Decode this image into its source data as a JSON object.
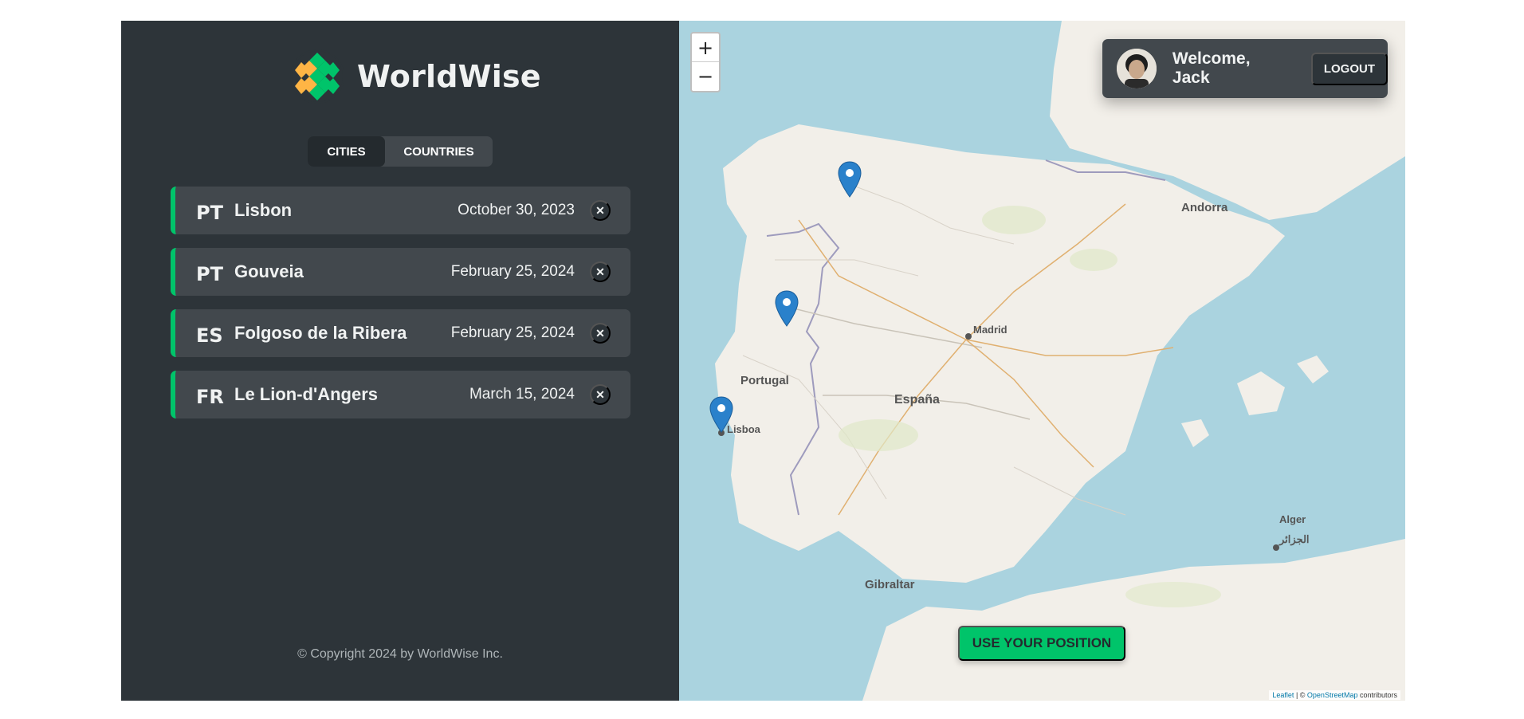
{
  "app": {
    "name": "WorldWise",
    "accent_color": "#00c46a",
    "panel_color": "#2d3439",
    "card_color": "#42484d"
  },
  "nav": {
    "tabs": [
      {
        "label": "CITIES",
        "active": true
      },
      {
        "label": "COUNTRIES",
        "active": false
      }
    ]
  },
  "cities": [
    {
      "code": "PT",
      "name": "Lisbon",
      "date": "October 30, 2023",
      "delete_icon": "close-icon"
    },
    {
      "code": "PT",
      "name": "Gouveia",
      "date": "February 25, 2024",
      "delete_icon": "close-icon"
    },
    {
      "code": "ES",
      "name": "Folgoso de la Ribera",
      "date": "February 25, 2024",
      "delete_icon": "close-icon"
    },
    {
      "code": "FR",
      "name": "Le Lion-d'Angers",
      "date": "March 15, 2024",
      "delete_icon": "close-icon"
    }
  ],
  "footer": {
    "copyright": "© Copyright 2024 by WorldWise Inc."
  },
  "map": {
    "zoom_in": "+",
    "zoom_out": "−",
    "geolocation_button": "USE YOUR POSITION",
    "labels": {
      "portugal": "Portugal",
      "espana": "España",
      "madrid": "Madrid",
      "lisboa": "Lisboa",
      "andorra": "Andorra",
      "gibraltar": "Gibraltar",
      "alger": "Alger",
      "alger_ar": "الجزائر"
    },
    "attribution": {
      "leaflet": "Leaflet",
      "separator": " | © ",
      "osm": "OpenStreetMap",
      "suffix": " contributors"
    }
  },
  "user": {
    "welcome": "Welcome, Jack",
    "logout": "LOGOUT"
  }
}
